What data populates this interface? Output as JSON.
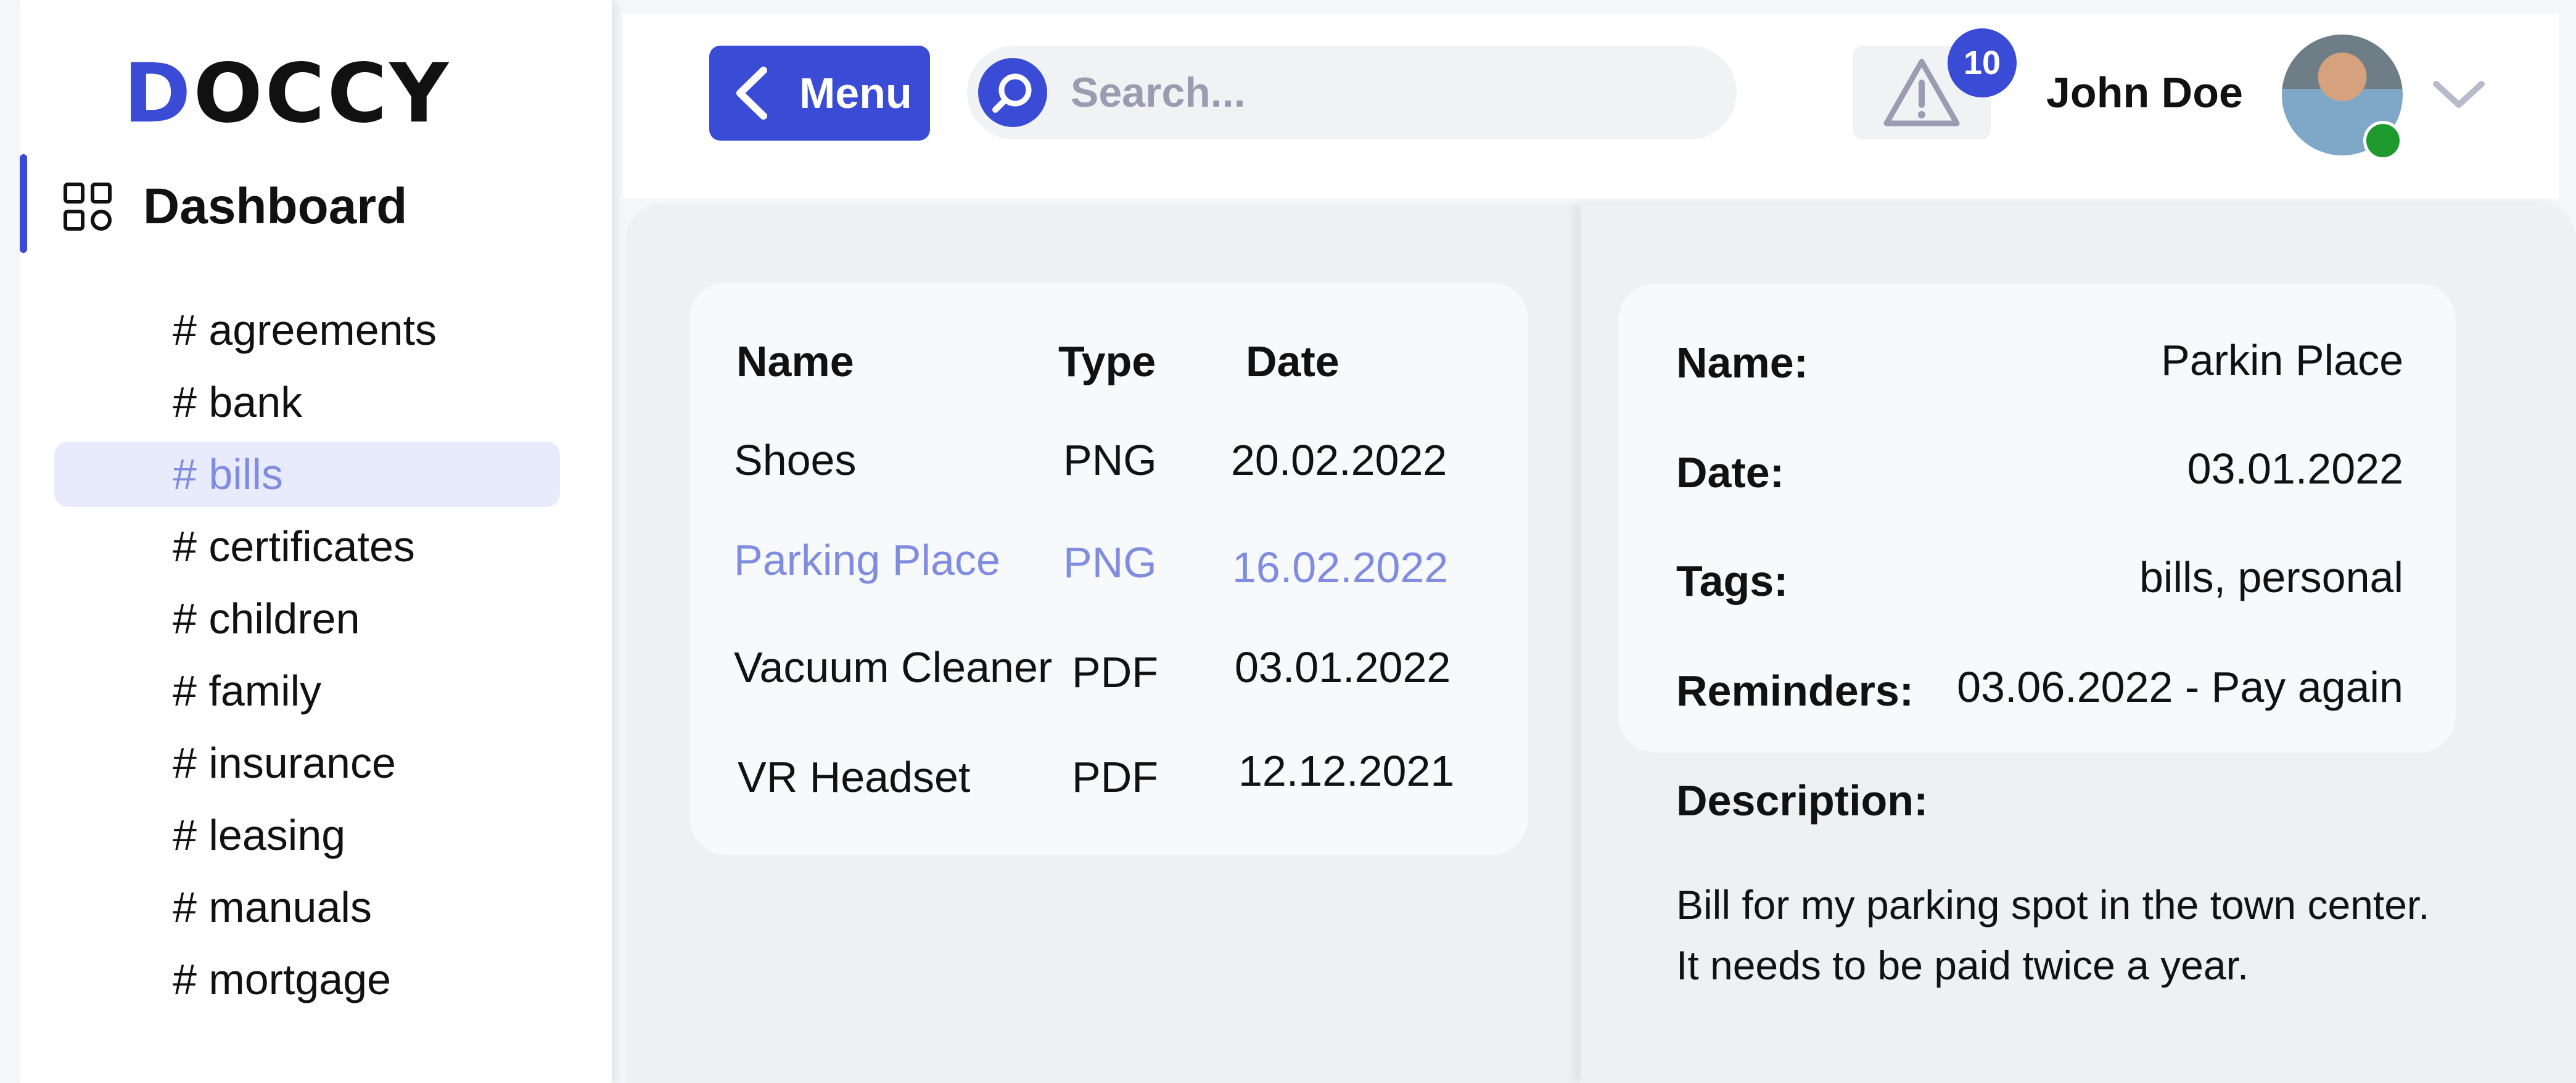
{
  "logo": {
    "first": "D",
    "rest": "OCCY"
  },
  "sidebar": {
    "dashboard_label": "Dashboard",
    "tags": [
      {
        "label": "# agreements",
        "active": false
      },
      {
        "label": "# bank",
        "active": false
      },
      {
        "label": "# bills",
        "active": true
      },
      {
        "label": "# certificates",
        "active": false
      },
      {
        "label": "# children",
        "active": false
      },
      {
        "label": "# family",
        "active": false
      },
      {
        "label": "# insurance",
        "active": false
      },
      {
        "label": "# leasing",
        "active": false
      },
      {
        "label": "# manuals",
        "active": false
      },
      {
        "label": "# mortgage",
        "active": false
      }
    ]
  },
  "header": {
    "menu_label": "Menu",
    "search_placeholder": "Search...",
    "alert_count": "10",
    "user_name": "John Doe"
  },
  "documents": {
    "columns": [
      "Name",
      "Type",
      "Date"
    ],
    "rows": [
      {
        "name": "Shoes",
        "type": "PNG",
        "date": "20.02.2022",
        "selected": false
      },
      {
        "name": "Parking Place",
        "type": "PNG",
        "date": "16.02.2022",
        "selected": true
      },
      {
        "name": "Vacuum Cleaner",
        "type": "PDF",
        "date": "03.01.2022",
        "selected": false
      },
      {
        "name": "VR Headset",
        "type": "PDF",
        "date": "12.12.2021",
        "selected": false
      }
    ]
  },
  "details": {
    "name_label": "Name:",
    "name_value": "Parkin Place",
    "date_label": "Date:",
    "date_value": "03.01.2022",
    "tags_label": "Tags:",
    "tags_value": "bills, personal",
    "reminders_label": "Reminders:",
    "reminders_value": "03.06.2022 - Pay again",
    "description_label": "Description:",
    "description_line1": "Bill for my parking spot in the town center.",
    "description_line2": "It needs to be paid twice a year."
  },
  "colors": {
    "accent": "#3a4bd6",
    "selected_text": "#7f8ce0",
    "selected_bg": "#e8ebfb",
    "panel_bg": "#edf1f4",
    "status_online": "#1f9a2e"
  },
  "icons": [
    "dashboard-grid-icon",
    "chevron-left-icon",
    "search-icon",
    "warning-icon",
    "chevron-down-icon"
  ]
}
